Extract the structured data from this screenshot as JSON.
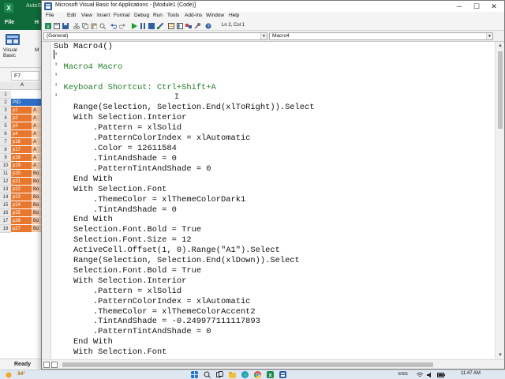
{
  "excel": {
    "autosave_label": "AutoS",
    "ribbon_tabs": [
      "File",
      "H"
    ],
    "visual_basic_label": "Visual\nBasic",
    "macros_label": "M",
    "name_box": "F7",
    "column_headers": [
      "A",
      ""
    ],
    "rows": [
      {
        "num": "1",
        "a": "",
        "b": "",
        "a_color": "#ffffff",
        "b_color": "#ffffff"
      },
      {
        "num": "2",
        "a": "PID",
        "b": "",
        "a_color": "#2e6ec4",
        "b_color": "#2e6ec4"
      },
      {
        "num": "3",
        "a": "p1",
        "b": "A",
        "a_color": "#e8772e",
        "b_color": "#f6c8a6"
      },
      {
        "num": "4",
        "a": "p2",
        "b": "A",
        "a_color": "#e8772e",
        "b_color": "#f6c8a6"
      },
      {
        "num": "5",
        "a": "p3",
        "b": "A",
        "a_color": "#e8772e",
        "b_color": "#f6c8a6"
      },
      {
        "num": "6",
        "a": "p4",
        "b": "A",
        "a_color": "#e8772e",
        "b_color": "#f6c8a6"
      },
      {
        "num": "7",
        "a": "p16",
        "b": "A",
        "a_color": "#e8772e",
        "b_color": "#f6c8a6"
      },
      {
        "num": "8",
        "a": "p17",
        "b": "A",
        "a_color": "#e8772e",
        "b_color": "#f6c8a6"
      },
      {
        "num": "9",
        "a": "p18",
        "b": "A",
        "a_color": "#e8772e",
        "b_color": "#f6c8a6"
      },
      {
        "num": "10",
        "a": "p19",
        "b": "A",
        "a_color": "#e8772e",
        "b_color": "#f6c8a6"
      },
      {
        "num": "11",
        "a": "p20",
        "b": "Bo",
        "a_color": "#e8772e",
        "b_color": "#f6c8a6"
      },
      {
        "num": "12",
        "a": "p21",
        "b": "Bo",
        "a_color": "#e8772e",
        "b_color": "#f6c8a6"
      },
      {
        "num": "13",
        "a": "p22",
        "b": "Bo",
        "a_color": "#e8772e",
        "b_color": "#f6c8a6"
      },
      {
        "num": "14",
        "a": "p23",
        "b": "Bo",
        "a_color": "#e8772e",
        "b_color": "#f6c8a6"
      },
      {
        "num": "15",
        "a": "p24",
        "b": "Bo",
        "a_color": "#e8772e",
        "b_color": "#f6c8a6"
      },
      {
        "num": "16",
        "a": "p25",
        "b": "Bo",
        "a_color": "#e8772e",
        "b_color": "#f6c8a6"
      },
      {
        "num": "17",
        "a": "p26",
        "b": "Bo",
        "a_color": "#e8772e",
        "b_color": "#f6c8a6"
      },
      {
        "num": "18",
        "a": "p27",
        "b": "Bo",
        "a_color": "#e8772e",
        "b_color": "#f6c8a6"
      }
    ],
    "status": "Ready"
  },
  "vbe": {
    "title": "Microsoft Visual Basic for Applications - [Module1 (Code)]",
    "window_buttons": {
      "minimize": "─",
      "maximize": "☐",
      "close": "✕"
    },
    "menu": [
      "File",
      "Edit",
      "View",
      "Insert",
      "Format",
      "Debug",
      "Run",
      "Tools",
      "Add-Ins",
      "Window",
      "Help"
    ],
    "cursor_position": "Ln 2, Col 1",
    "object_combo": "(General)",
    "procedure_combo": "Macro4",
    "code_lines": [
      {
        "text": "Sub Macro4()",
        "type": "code"
      },
      {
        "text": "'",
        "type": "comment"
      },
      {
        "text": "' Macro4 Macro",
        "type": "comment"
      },
      {
        "text": "'",
        "type": "comment"
      },
      {
        "text": "' Keyboard Shortcut: Ctrl+Shift+A",
        "type": "comment"
      },
      {
        "text": "'",
        "type": "comment"
      },
      {
        "text": "    Range(Selection, Selection.End(xlToRight)).Select",
        "type": "code"
      },
      {
        "text": "    With Selection.Interior",
        "type": "code"
      },
      {
        "text": "        .Pattern = xlSolid",
        "type": "code"
      },
      {
        "text": "        .PatternColorIndex = xlAutomatic",
        "type": "code"
      },
      {
        "text": "        .Color = 12611584",
        "type": "code"
      },
      {
        "text": "        .TintAndShade = 0",
        "type": "code"
      },
      {
        "text": "        .PatternTintAndShade = 0",
        "type": "code"
      },
      {
        "text": "    End With",
        "type": "code"
      },
      {
        "text": "    With Selection.Font",
        "type": "code"
      },
      {
        "text": "        .ThemeColor = xlThemeColorDark1",
        "type": "code"
      },
      {
        "text": "        .TintAndShade = 0",
        "type": "code"
      },
      {
        "text": "    End With",
        "type": "code"
      },
      {
        "text": "    Selection.Font.Bold = True",
        "type": "code"
      },
      {
        "text": "    Selection.Font.Size = 12",
        "type": "code"
      },
      {
        "text": "    ActiveCell.Offset(1, 0).Range(\"A1\").Select",
        "type": "code"
      },
      {
        "text": "    Range(Selection, Selection.End(xlDown)).Select",
        "type": "code"
      },
      {
        "text": "    Selection.Font.Bold = True",
        "type": "code"
      },
      {
        "text": "    With Selection.Interior",
        "type": "code"
      },
      {
        "text": "        .Pattern = xlSolid",
        "type": "code"
      },
      {
        "text": "        .PatternColorIndex = xlAutomatic",
        "type": "code"
      },
      {
        "text": "        .ThemeColor = xlThemeColorAccent2",
        "type": "code"
      },
      {
        "text": "        .TintAndShade = -0.249977111117893",
        "type": "code"
      },
      {
        "text": "        .PatternTintAndShade = 0",
        "type": "code"
      },
      {
        "text": "    End With",
        "type": "code"
      },
      {
        "text": "    With Selection.Font",
        "type": "code"
      }
    ]
  },
  "taskbar": {
    "weather": "34°",
    "language": "ENG",
    "clock": "11:47 AM"
  },
  "colors": {
    "excel_green": "#0f6b3a",
    "comment_green": "#1f7f24"
  }
}
